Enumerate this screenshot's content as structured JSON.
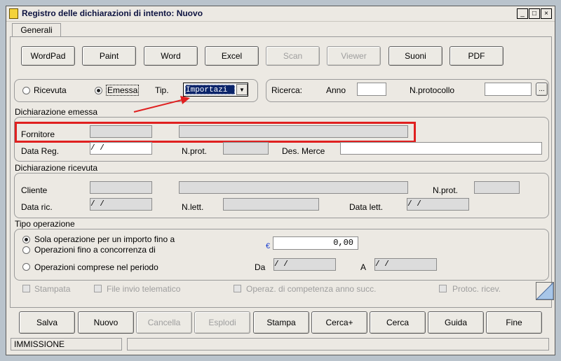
{
  "window": {
    "title": "Registro delle dichiarazioni di intento: Nuovo",
    "min": "_",
    "max": "□",
    "close": "×"
  },
  "tabs": [
    "Generali"
  ],
  "toolbar": {
    "wordpad": "WordPad",
    "paint": "Paint",
    "word": "Word",
    "excel": "Excel",
    "scan": "Scan",
    "viewer": "Viewer",
    "suoni": "Suoni",
    "pdf": "PDF"
  },
  "type_row": {
    "ricevuta": "Ricevuta",
    "emessa": "Emessa",
    "tip_label": "Tip.",
    "tip_value": "Importazi",
    "ricerca": "Ricerca:",
    "anno": "Anno",
    "nprotocollo": "N.protocollo",
    "lookup": "..."
  },
  "emessa": {
    "heading": "Dichiarazione emessa",
    "fornitore": "Fornitore",
    "data_reg": "Data Reg.",
    "data_reg_value": "  /  /",
    "nprot": "N.prot.",
    "des_merce": "Des. Merce"
  },
  "ricevuta": {
    "heading": "Dichiarazione ricevuta",
    "cliente": "Cliente",
    "nprot": "N.prot.",
    "data_ric": "Data ric.",
    "data_ric_value": "  /  /",
    "nlett": "N.lett.",
    "data_lett": "Data lett.",
    "data_lett_value": "  /  /"
  },
  "operazione": {
    "heading": "Tipo operazione",
    "opt1": "Sola operazione per un importo fino a",
    "opt2": "Operazioni fino a concorrenza di",
    "opt3": "Operazioni comprese nel periodo",
    "currency": "€",
    "amount": "0,00",
    "da": "Da",
    "da_value": "  /  /",
    "a": "A",
    "a_value": "  /  /"
  },
  "flags": {
    "stampata": "Stampata",
    "file_invio": "File invio telematico",
    "operaz": "Operaz. di competenza anno succ.",
    "protoc": "Protoc. ricev."
  },
  "actions": {
    "salva": "Salva",
    "nuovo": "Nuovo",
    "cancella": "Cancella",
    "esplodi": "Esplodi",
    "stampa": "Stampa",
    "cercaplus": "Cerca+",
    "cerca": "Cerca",
    "guida": "Guida",
    "fine": "Fine"
  },
  "status": {
    "mode": "IMMISSIONE"
  },
  "colors": {
    "highlight": "#e02020",
    "arrow": "#e02020"
  }
}
